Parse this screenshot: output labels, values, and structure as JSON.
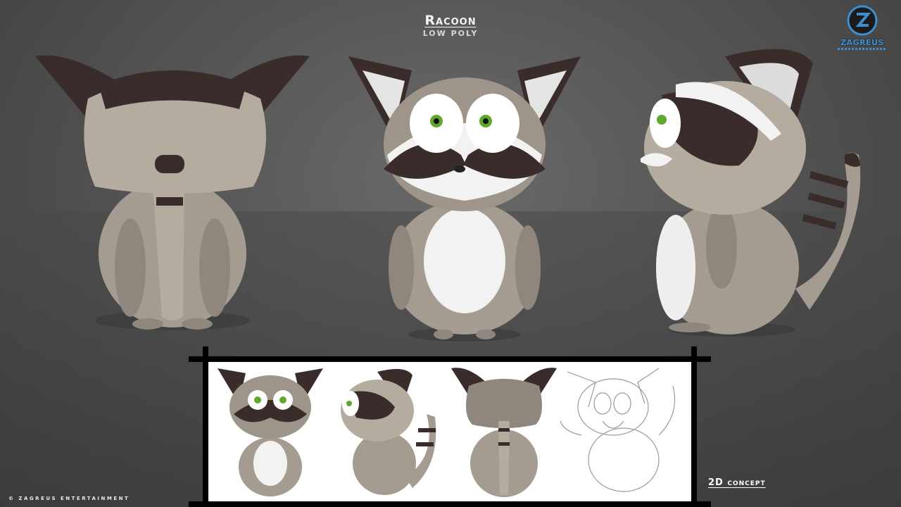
{
  "header": {
    "title": "Racoon",
    "subtitle": "LOW POLY"
  },
  "logo": {
    "brand": "ZAGREUS"
  },
  "footer": {
    "copyright": "© ZAGREUS ENTERTAINMENT"
  },
  "concept": {
    "label": "2D concept"
  },
  "icons": [
    "zagreus-logo-icon"
  ],
  "colors": {
    "fur_dark": "#3a2c2a",
    "fur_grey": "#a59c91",
    "fur_light": "#efefef",
    "eye": "#5fa82e",
    "brand": "#3b8fd1"
  }
}
